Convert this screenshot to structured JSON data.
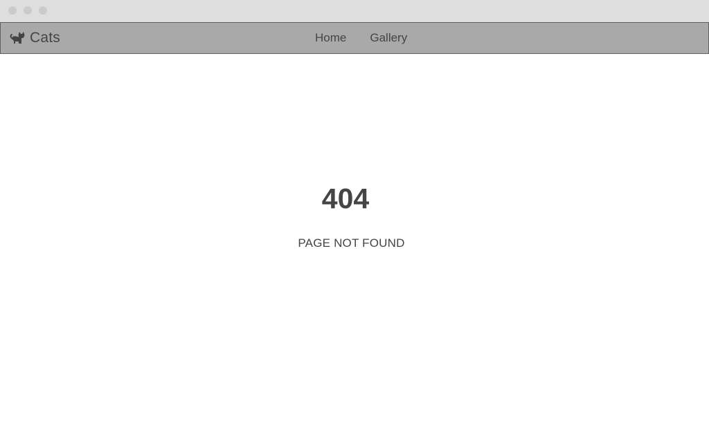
{
  "window": {
    "titlebar_color": "#dedede",
    "traffic_light_color": "#cbcbcb"
  },
  "navbar": {
    "background_color": "#a9a9a9",
    "brand": {
      "icon": "cat-icon",
      "label": "Cats"
    },
    "links": [
      {
        "label": "Home"
      },
      {
        "label": "Gallery"
      }
    ]
  },
  "main": {
    "error_code": "404",
    "error_message": "PAGE NOT FOUND",
    "text_color": "#444444"
  }
}
